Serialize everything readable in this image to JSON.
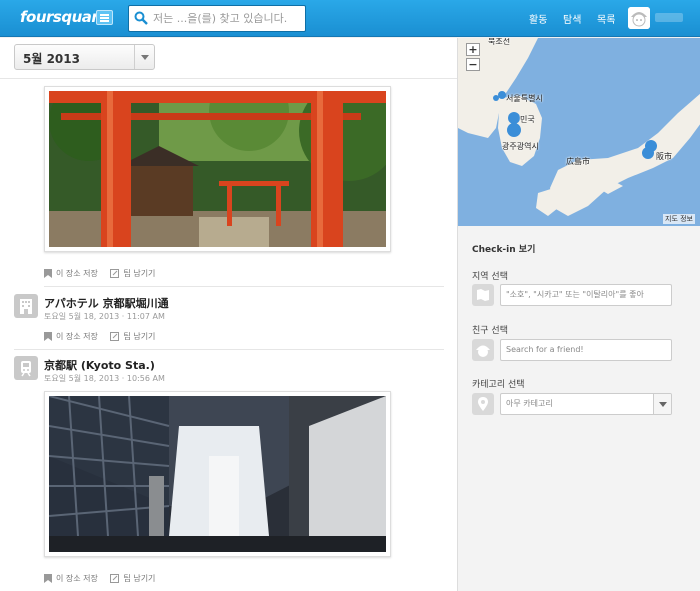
{
  "header": {
    "logo": "foursquare",
    "search_placeholder": "저는 ...을(를) 찾고 있습니다.",
    "nav": [
      "활동",
      "탐색",
      "목록"
    ]
  },
  "timeline": {
    "month": "5월 2013"
  },
  "entries": [
    {
      "actions": [
        "이 장소 저장",
        "팁 남기기"
      ]
    },
    {
      "venue": "アパホテル 京都駅堀川通",
      "time": "토요일 5월 18, 2013 · 11:07 AM",
      "icon": "hotel-icon",
      "actions": [
        "이 장소 저장",
        "팁 남기기"
      ]
    },
    {
      "venue": "京都駅 (Kyoto Sta.)",
      "time": "토요일 5월 18, 2013 · 10:56 AM",
      "icon": "train-icon",
      "actions": [
        "이 장소 저장",
        "팁 남기기"
      ]
    }
  ],
  "map": {
    "labels": [
      "북조선",
      "서울특별시",
      "민국",
      "광주광역시",
      "広島市",
      "阪市"
    ],
    "zoom_in": "+",
    "zoom_out": "−",
    "info": "지도 정보"
  },
  "sidebar": {
    "title": "Check-in 보기",
    "region_label": "지역 선택",
    "region_placeholder": "\"소호\", \"시카고\" 또는 \"이탈리아\"를 좋아",
    "friend_label": "친구 선택",
    "friend_placeholder": "Search for a friend!",
    "category_label": "카테고리 선택",
    "category_value": "아무 카테고리"
  },
  "colors": {
    "brand_blue": "#1f9bdc",
    "torii_red": "#d9441e",
    "map_water": "#7fb0e0",
    "map_land": "#f2efe8"
  }
}
